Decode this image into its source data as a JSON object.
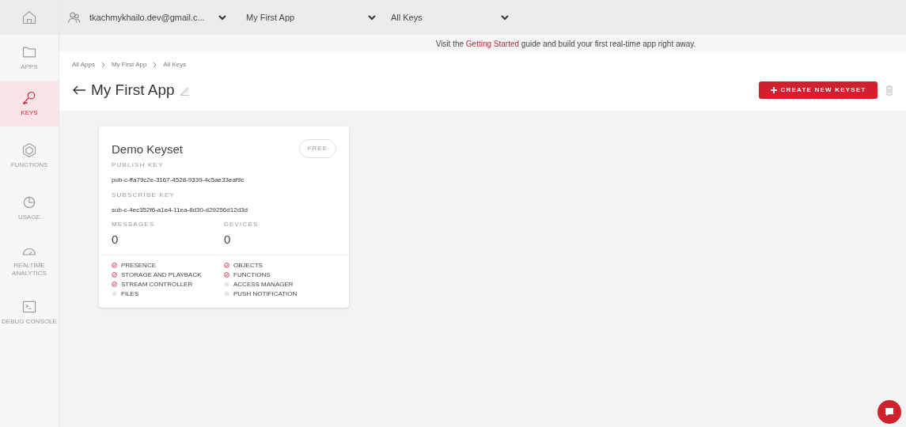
{
  "sidebar": {
    "items": [
      {
        "kind": "home",
        "selected": false
      },
      {
        "kind": "folder",
        "label": "APPS",
        "selected": false
      },
      {
        "kind": "key",
        "label": "KEYS",
        "selected": true
      },
      {
        "kind": "cube",
        "label": "FUNCTIONS",
        "selected": false
      },
      {
        "kind": "pie",
        "label": "USAGE",
        "selected": false
      },
      {
        "kind": "gauge",
        "label": "REALTIME ANALYTICS",
        "selected": false
      },
      {
        "kind": "terminal",
        "label": "DEBUG CONSOLE",
        "selected": false
      }
    ]
  },
  "topbar": {
    "account": "tkachmykhailo.dev@gmail.c...",
    "app": "My First App",
    "keys": "All Keys"
  },
  "banner": {
    "before": "Visit the",
    "link": "Getting Started",
    "after": "guide and build your first real-time app right away."
  },
  "breadcrumb": [
    "All Apps",
    "My First App",
    "All Keys"
  ],
  "page_title": "My First App",
  "create_button": "CREATE NEW KEYSET",
  "keyset": {
    "name": "Demo Keyset",
    "plan": "FREE",
    "publish_label": "PUBLISH KEY",
    "publish_key": "pub-c-ffa79c2e-3167-4528-9339-4c5ae33eaf9c",
    "subscribe_label": "SUBSCRIBE KEY",
    "subscribe_key": "sub-c-4ec352f6-a1e4-11ea-8d30-d29256d12d3d",
    "stats": [
      {
        "label": "MESSAGES",
        "value": "0"
      },
      {
        "label": "DEVICES",
        "value": "0"
      }
    ],
    "features": [
      {
        "label": "PRESENCE",
        "enabled": true
      },
      {
        "label": "OBJECTS",
        "enabled": true
      },
      {
        "label": "STORAGE AND PLAYBACK",
        "enabled": true
      },
      {
        "label": "FUNCTIONS",
        "enabled": true
      },
      {
        "label": "STREAM CONTROLLER",
        "enabled": true
      },
      {
        "label": "ACCESS MANAGER",
        "enabled": false
      },
      {
        "label": "FILES",
        "enabled": false
      },
      {
        "label": "PUSH NOTIFICATION",
        "enabled": false
      }
    ]
  }
}
